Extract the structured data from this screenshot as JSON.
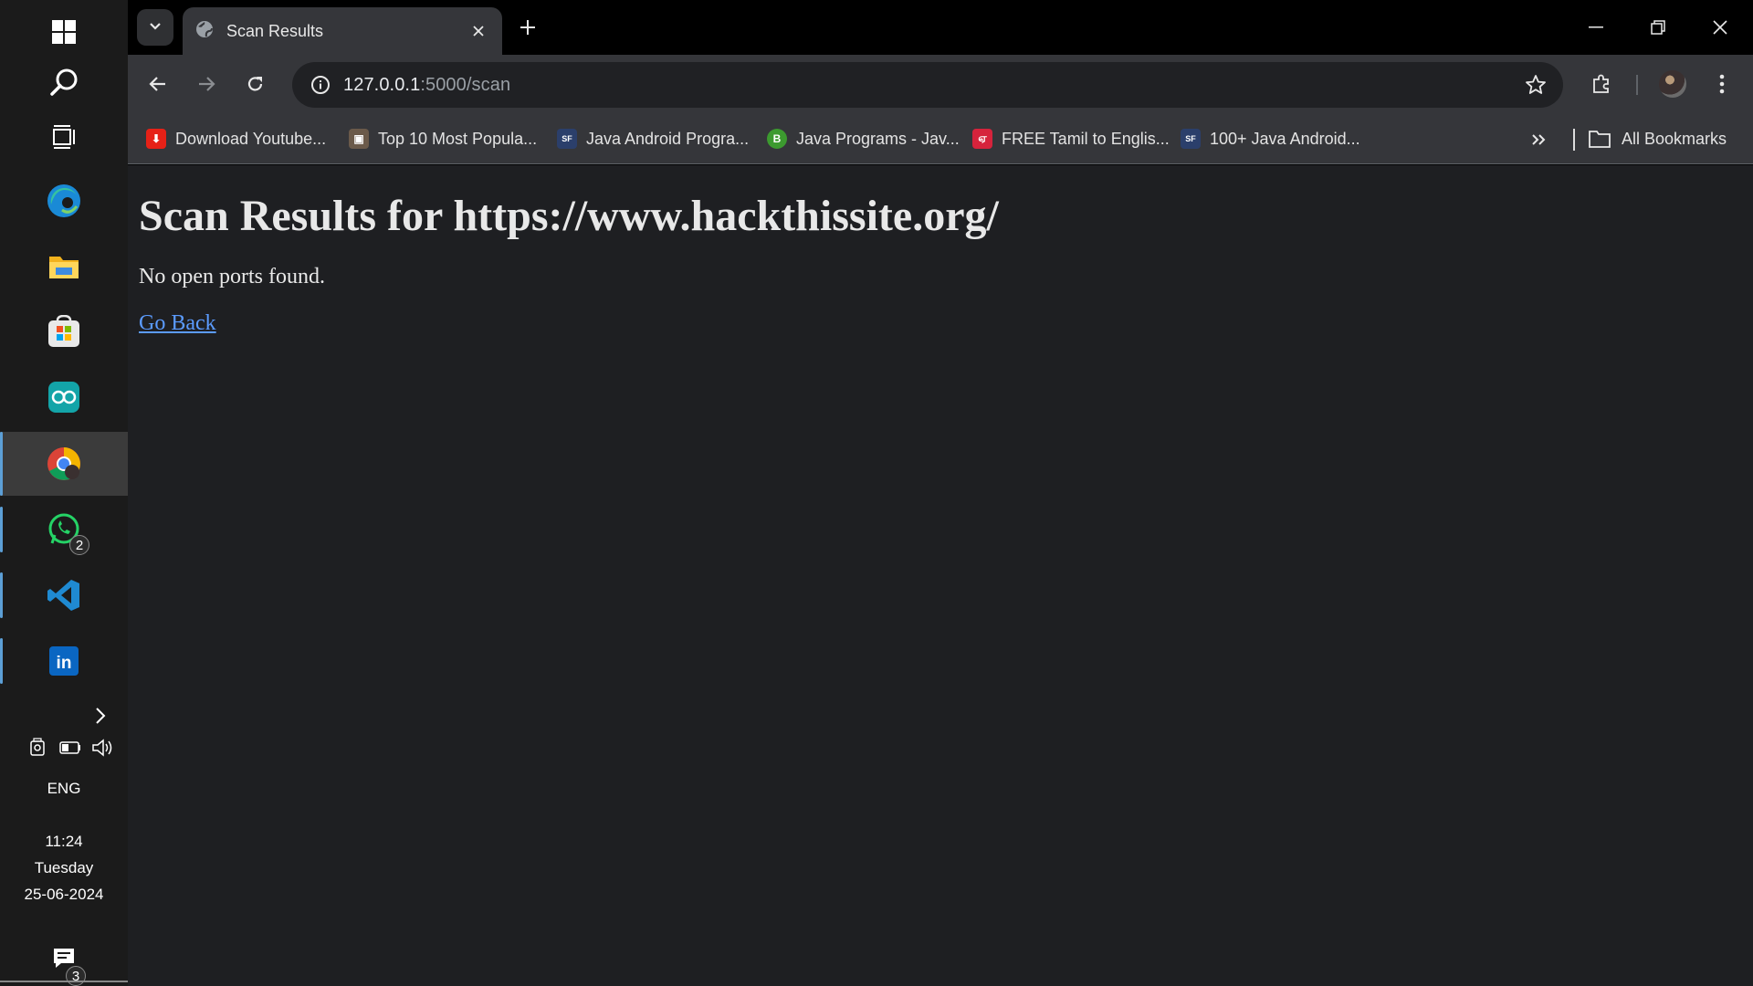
{
  "taskbar": {
    "apps": [
      {
        "name": "start",
        "icon": "windows-icon"
      },
      {
        "name": "search",
        "icon": "search-icon"
      },
      {
        "name": "task-view",
        "icon": "task-view-icon"
      },
      {
        "name": "edge",
        "icon": "edge-icon"
      },
      {
        "name": "file-explorer",
        "icon": "folder-icon"
      },
      {
        "name": "microsoft-store",
        "icon": "store-icon"
      },
      {
        "name": "arduino",
        "icon": "arduino-icon"
      },
      {
        "name": "chrome",
        "icon": "chrome-icon",
        "active": true
      },
      {
        "name": "whatsapp",
        "icon": "whatsapp-icon",
        "badge": "2"
      },
      {
        "name": "vscode",
        "icon": "vscode-icon"
      },
      {
        "name": "linkedin",
        "icon": "linkedin-icon"
      }
    ],
    "whatsapp_badge": "2",
    "language": "ENG",
    "time": "11:24",
    "day": "Tuesday",
    "date": "25-06-2024",
    "notifications_badge": "3"
  },
  "browser": {
    "tab": {
      "title": "Scan Results",
      "icon": "globe-icon"
    },
    "address": {
      "host": "127.0.0.1",
      "path": ":5000/scan"
    },
    "bookmarks": [
      {
        "label": "Download Youtube...",
        "icon_color": "#e62117",
        "icon_char": "⬇"
      },
      {
        "label": "Top 10 Most Popula...",
        "icon_color": "#6b5a4a",
        "icon_char": "▣"
      },
      {
        "label": "Java Android Progra...",
        "icon_color": "#2b3f6b",
        "icon_char": "SF"
      },
      {
        "label": "Java Programs - Jav...",
        "icon_color": "#3c9a2f",
        "icon_char": "B"
      },
      {
        "label": "FREE Tamil to Englis...",
        "icon_color": "#d6233c",
        "icon_char": "ஏ"
      },
      {
        "label": "100+ Java Android...",
        "icon_color": "#2b3f6b",
        "icon_char": "SF"
      }
    ],
    "all_bookmarks_label": "All Bookmarks"
  },
  "page": {
    "heading": "Scan Results for https://www.hackthissite.org/",
    "message": "No open ports found.",
    "back_link": "Go Back"
  },
  "colors": {
    "accent": "#5c9fd6",
    "link": "#5b9bff",
    "page_bg": "#1e1f22",
    "toolbar_bg": "#35363a"
  }
}
